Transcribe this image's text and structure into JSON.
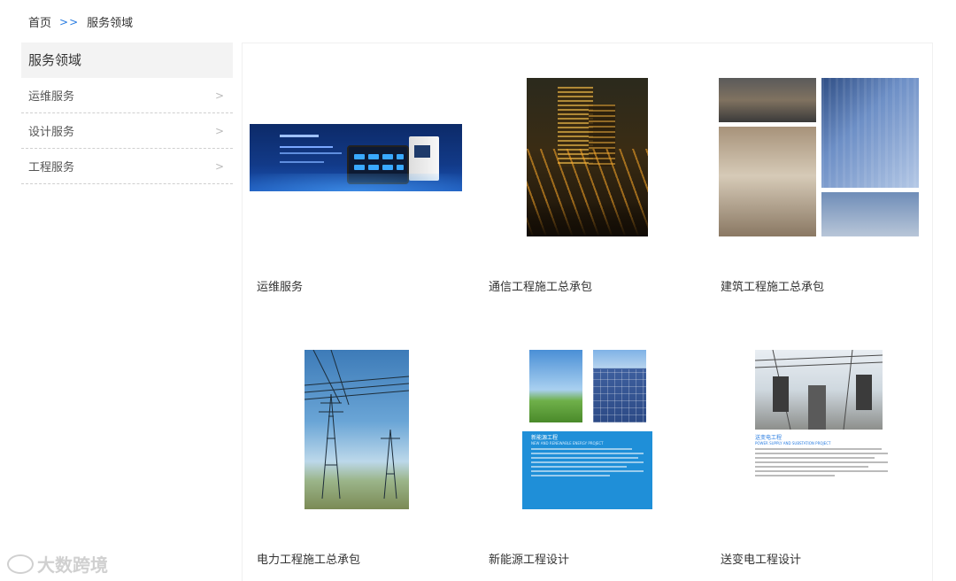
{
  "breadcrumb": {
    "home": "首页",
    "separator": ">>",
    "current": "服务领域"
  },
  "sidebar": {
    "title": "服务领域",
    "items": [
      {
        "label": "运维服务",
        "icon": "chevron-right-icon"
      },
      {
        "label": "设计服务",
        "icon": "chevron-right-icon"
      },
      {
        "label": "工程服务",
        "icon": "chevron-right-icon"
      }
    ]
  },
  "grid": {
    "cards": [
      {
        "label": "运维服务",
        "image": "power-monitoring-banner"
      },
      {
        "label": "通信工程施工总承包",
        "image": "city-night-traffic"
      },
      {
        "label": "建筑工程施工总承包",
        "image": "architecture-collage"
      },
      {
        "label": "电力工程施工总承包",
        "image": "power-pylons"
      },
      {
        "label": "新能源工程设计",
        "image": "wind-solar-energy"
      },
      {
        "label": "送变电工程设计",
        "image": "substation-equipment"
      }
    ],
    "card5_text": {
      "heading": "新能源工程",
      "subheading": "NEW AND RENEWABLE ENERGY PROJECT"
    },
    "card6_text": {
      "heading": "送变电工程",
      "subheading": "POWER SUPPLY AND SUBSTATION PROJECT"
    }
  },
  "watermark": {
    "text": "大数跨境"
  },
  "colors": {
    "accent": "#2a7de1",
    "sidebar_header_bg": "#f3f3f3",
    "text": "#333333"
  }
}
